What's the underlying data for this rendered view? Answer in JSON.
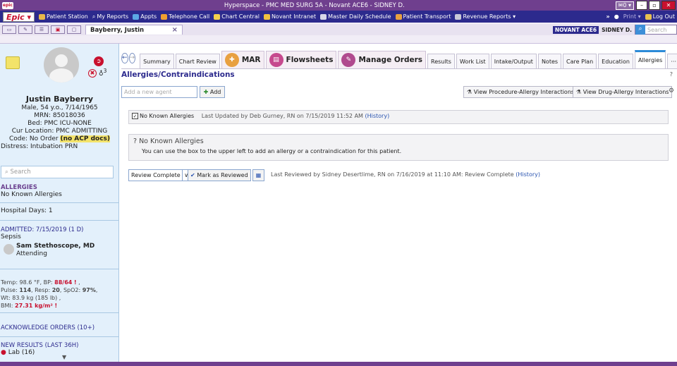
{
  "titlebar": {
    "title": "Hyperspace - PMC MED SURG 5A - Novant ACE6 - SIDNEY D.",
    "mail": "✉0 ▾",
    "minimize": "–",
    "maximize": "▫",
    "close": "✕"
  },
  "menubar": {
    "epic": "Epic ▾",
    "items": [
      "Patient Station",
      "My Reports",
      "Appts",
      "Telephone Call",
      "Chart Central",
      "Novant Intranet",
      "Master Daily Schedule",
      "Patient Transport",
      "Revenue Reports ▾"
    ],
    "overflow": "»",
    "print": "Print ▾",
    "logout": "Log Out"
  },
  "patient_bar": {
    "tab_label": "Bayberry, Justin",
    "close": "×",
    "dept": "NOVANT ACE6",
    "user": "SIDNEY D.",
    "search_placeholder": "Search"
  },
  "sidebar": {
    "name": "Justin Bayberry",
    "demo": "Male, 54 y.o., 7/14/1965",
    "mrn": "MRN: 85018036",
    "bed": "Bed: PMC ICU-NONE",
    "location": "Cur Location: PMC ADMITTING",
    "code_prefix": "Code: No Order ",
    "code_flag": "(no ACP docs)",
    "distress": "Distress: Intubation PRN",
    "badge_count": "3",
    "search_placeholder": "Search",
    "allergies_header": "ALLERGIES",
    "allergies_value": "No Known Allergies",
    "hospital_days": "Hospital Days: 1",
    "admitted_header": "ADMITTED: 7/15/2019 (1 D)",
    "diagnosis": "Sepsis",
    "attending_name": "Sam Stethoscope, MD",
    "attending_role": "Attending",
    "vitals_line1a": "Temp: 98.6 °F, BP: ",
    "vitals_bp": "88/64",
    "vitals_flag": "!",
    "vitals_line1b": " ,",
    "vitals_line2a": "Pulse: ",
    "vitals_pulse": "114",
    "vitals_line2b": ", Resp: ",
    "vitals_resp": "20",
    "vitals_line2c": ", SpO2: ",
    "vitals_spo2": "97%",
    "vitals_line2d": ",",
    "vitals_line3": "Wt: 83.9 kg (185 lb) ,",
    "vitals_bmi_label": "BMI: ",
    "vitals_bmi": "27.31 kg/m²",
    "vitals_bmi_flag": "!",
    "ack_orders": "ACKNOWLEDGE ORDERS (10+)",
    "new_results": "NEW RESULTS (LAST 36H)",
    "lab": "Lab (16)"
  },
  "tabs": {
    "summary": "Summary",
    "chart_review": "Chart Review",
    "mar": "MAR",
    "flowsheets": "Flowsheets",
    "manage_orders": "Manage Orders",
    "results": "Results",
    "work_list": "Work List",
    "intake_output": "Intake/Output",
    "notes": "Notes",
    "care_plan": "Care Plan",
    "education": "Education",
    "allergies": "Allergies",
    "more": "··· ▾"
  },
  "main": {
    "title": "Allergies/Contraindications",
    "add_placeholder": "Add a new agent",
    "add_button": "Add",
    "view_proc": "View Procedure-Allergy Interactions",
    "view_drug": "View Drug-Allergy Interactions",
    "nka_check": "No Known Allergies",
    "last_updated": "Last Updated by Deb Gurney, RN on 7/15/2019 11:52 AM",
    "history": "(History)",
    "nka_title": "No Known Allergies",
    "nka_hint": "You can use the box to the upper left to add an allergy or a contraindication for this patient.",
    "review_select": "Review Complete",
    "mark_reviewed": "Mark as Reviewed",
    "last_reviewed": "Last Reviewed by Sidney Desertlime, RN on 7/16/2019 at 11:10 AM: Review Complete",
    "history2": "(History)"
  }
}
